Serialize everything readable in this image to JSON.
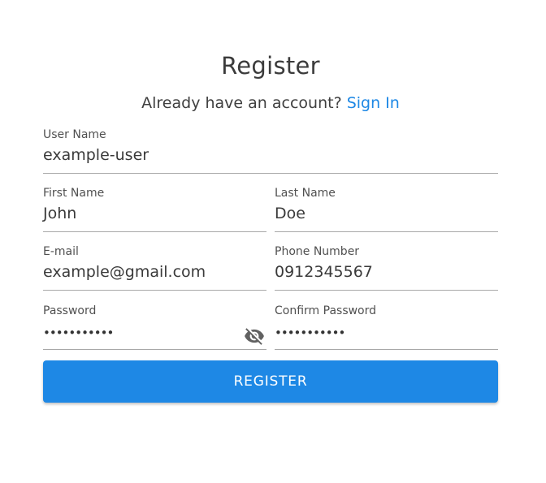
{
  "header": {
    "title": "Register",
    "prompt": "Already have an account?",
    "sign_in_link": "Sign In"
  },
  "fields": {
    "username": {
      "label": "User Name",
      "value": "example-user"
    },
    "first_name": {
      "label": "First Name",
      "value": "John"
    },
    "last_name": {
      "label": "Last Name",
      "value": "Doe"
    },
    "email": {
      "label": "E-mail",
      "value": "example@gmail.com"
    },
    "phone": {
      "label": "Phone Number",
      "value": "0912345567"
    },
    "password": {
      "label": "Password",
      "value": "•••••••••••"
    },
    "confirm_password": {
      "label": "Confirm Password",
      "value": "•••••••••••"
    }
  },
  "icons": {
    "password_visibility": "eye-off-icon"
  },
  "colors": {
    "accent": "#1e88e5",
    "underline": "#a8a8a8",
    "icon": "#616161"
  },
  "submit": {
    "label": "REGISTER"
  }
}
